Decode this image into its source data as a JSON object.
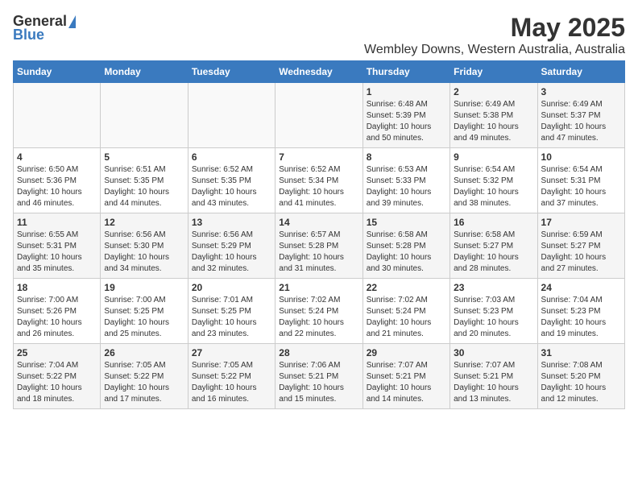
{
  "logo": {
    "general": "General",
    "blue": "Blue"
  },
  "title": "May 2025",
  "subtitle": "Wembley Downs, Western Australia, Australia",
  "days_header": [
    "Sunday",
    "Monday",
    "Tuesday",
    "Wednesday",
    "Thursday",
    "Friday",
    "Saturday"
  ],
  "weeks": [
    [
      {
        "day": "",
        "info": ""
      },
      {
        "day": "",
        "info": ""
      },
      {
        "day": "",
        "info": ""
      },
      {
        "day": "",
        "info": ""
      },
      {
        "day": "1",
        "info": "Sunrise: 6:48 AM\nSunset: 5:39 PM\nDaylight: 10 hours\nand 50 minutes."
      },
      {
        "day": "2",
        "info": "Sunrise: 6:49 AM\nSunset: 5:38 PM\nDaylight: 10 hours\nand 49 minutes."
      },
      {
        "day": "3",
        "info": "Sunrise: 6:49 AM\nSunset: 5:37 PM\nDaylight: 10 hours\nand 47 minutes."
      }
    ],
    [
      {
        "day": "4",
        "info": "Sunrise: 6:50 AM\nSunset: 5:36 PM\nDaylight: 10 hours\nand 46 minutes."
      },
      {
        "day": "5",
        "info": "Sunrise: 6:51 AM\nSunset: 5:35 PM\nDaylight: 10 hours\nand 44 minutes."
      },
      {
        "day": "6",
        "info": "Sunrise: 6:52 AM\nSunset: 5:35 PM\nDaylight: 10 hours\nand 43 minutes."
      },
      {
        "day": "7",
        "info": "Sunrise: 6:52 AM\nSunset: 5:34 PM\nDaylight: 10 hours\nand 41 minutes."
      },
      {
        "day": "8",
        "info": "Sunrise: 6:53 AM\nSunset: 5:33 PM\nDaylight: 10 hours\nand 39 minutes."
      },
      {
        "day": "9",
        "info": "Sunrise: 6:54 AM\nSunset: 5:32 PM\nDaylight: 10 hours\nand 38 minutes."
      },
      {
        "day": "10",
        "info": "Sunrise: 6:54 AM\nSunset: 5:31 PM\nDaylight: 10 hours\nand 37 minutes."
      }
    ],
    [
      {
        "day": "11",
        "info": "Sunrise: 6:55 AM\nSunset: 5:31 PM\nDaylight: 10 hours\nand 35 minutes."
      },
      {
        "day": "12",
        "info": "Sunrise: 6:56 AM\nSunset: 5:30 PM\nDaylight: 10 hours\nand 34 minutes."
      },
      {
        "day": "13",
        "info": "Sunrise: 6:56 AM\nSunset: 5:29 PM\nDaylight: 10 hours\nand 32 minutes."
      },
      {
        "day": "14",
        "info": "Sunrise: 6:57 AM\nSunset: 5:28 PM\nDaylight: 10 hours\nand 31 minutes."
      },
      {
        "day": "15",
        "info": "Sunrise: 6:58 AM\nSunset: 5:28 PM\nDaylight: 10 hours\nand 30 minutes."
      },
      {
        "day": "16",
        "info": "Sunrise: 6:58 AM\nSunset: 5:27 PM\nDaylight: 10 hours\nand 28 minutes."
      },
      {
        "day": "17",
        "info": "Sunrise: 6:59 AM\nSunset: 5:27 PM\nDaylight: 10 hours\nand 27 minutes."
      }
    ],
    [
      {
        "day": "18",
        "info": "Sunrise: 7:00 AM\nSunset: 5:26 PM\nDaylight: 10 hours\nand 26 minutes."
      },
      {
        "day": "19",
        "info": "Sunrise: 7:00 AM\nSunset: 5:25 PM\nDaylight: 10 hours\nand 25 minutes."
      },
      {
        "day": "20",
        "info": "Sunrise: 7:01 AM\nSunset: 5:25 PM\nDaylight: 10 hours\nand 23 minutes."
      },
      {
        "day": "21",
        "info": "Sunrise: 7:02 AM\nSunset: 5:24 PM\nDaylight: 10 hours\nand 22 minutes."
      },
      {
        "day": "22",
        "info": "Sunrise: 7:02 AM\nSunset: 5:24 PM\nDaylight: 10 hours\nand 21 minutes."
      },
      {
        "day": "23",
        "info": "Sunrise: 7:03 AM\nSunset: 5:23 PM\nDaylight: 10 hours\nand 20 minutes."
      },
      {
        "day": "24",
        "info": "Sunrise: 7:04 AM\nSunset: 5:23 PM\nDaylight: 10 hours\nand 19 minutes."
      }
    ],
    [
      {
        "day": "25",
        "info": "Sunrise: 7:04 AM\nSunset: 5:22 PM\nDaylight: 10 hours\nand 18 minutes."
      },
      {
        "day": "26",
        "info": "Sunrise: 7:05 AM\nSunset: 5:22 PM\nDaylight: 10 hours\nand 17 minutes."
      },
      {
        "day": "27",
        "info": "Sunrise: 7:05 AM\nSunset: 5:22 PM\nDaylight: 10 hours\nand 16 minutes."
      },
      {
        "day": "28",
        "info": "Sunrise: 7:06 AM\nSunset: 5:21 PM\nDaylight: 10 hours\nand 15 minutes."
      },
      {
        "day": "29",
        "info": "Sunrise: 7:07 AM\nSunset: 5:21 PM\nDaylight: 10 hours\nand 14 minutes."
      },
      {
        "day": "30",
        "info": "Sunrise: 7:07 AM\nSunset: 5:21 PM\nDaylight: 10 hours\nand 13 minutes."
      },
      {
        "day": "31",
        "info": "Sunrise: 7:08 AM\nSunset: 5:20 PM\nDaylight: 10 hours\nand 12 minutes."
      }
    ]
  ]
}
